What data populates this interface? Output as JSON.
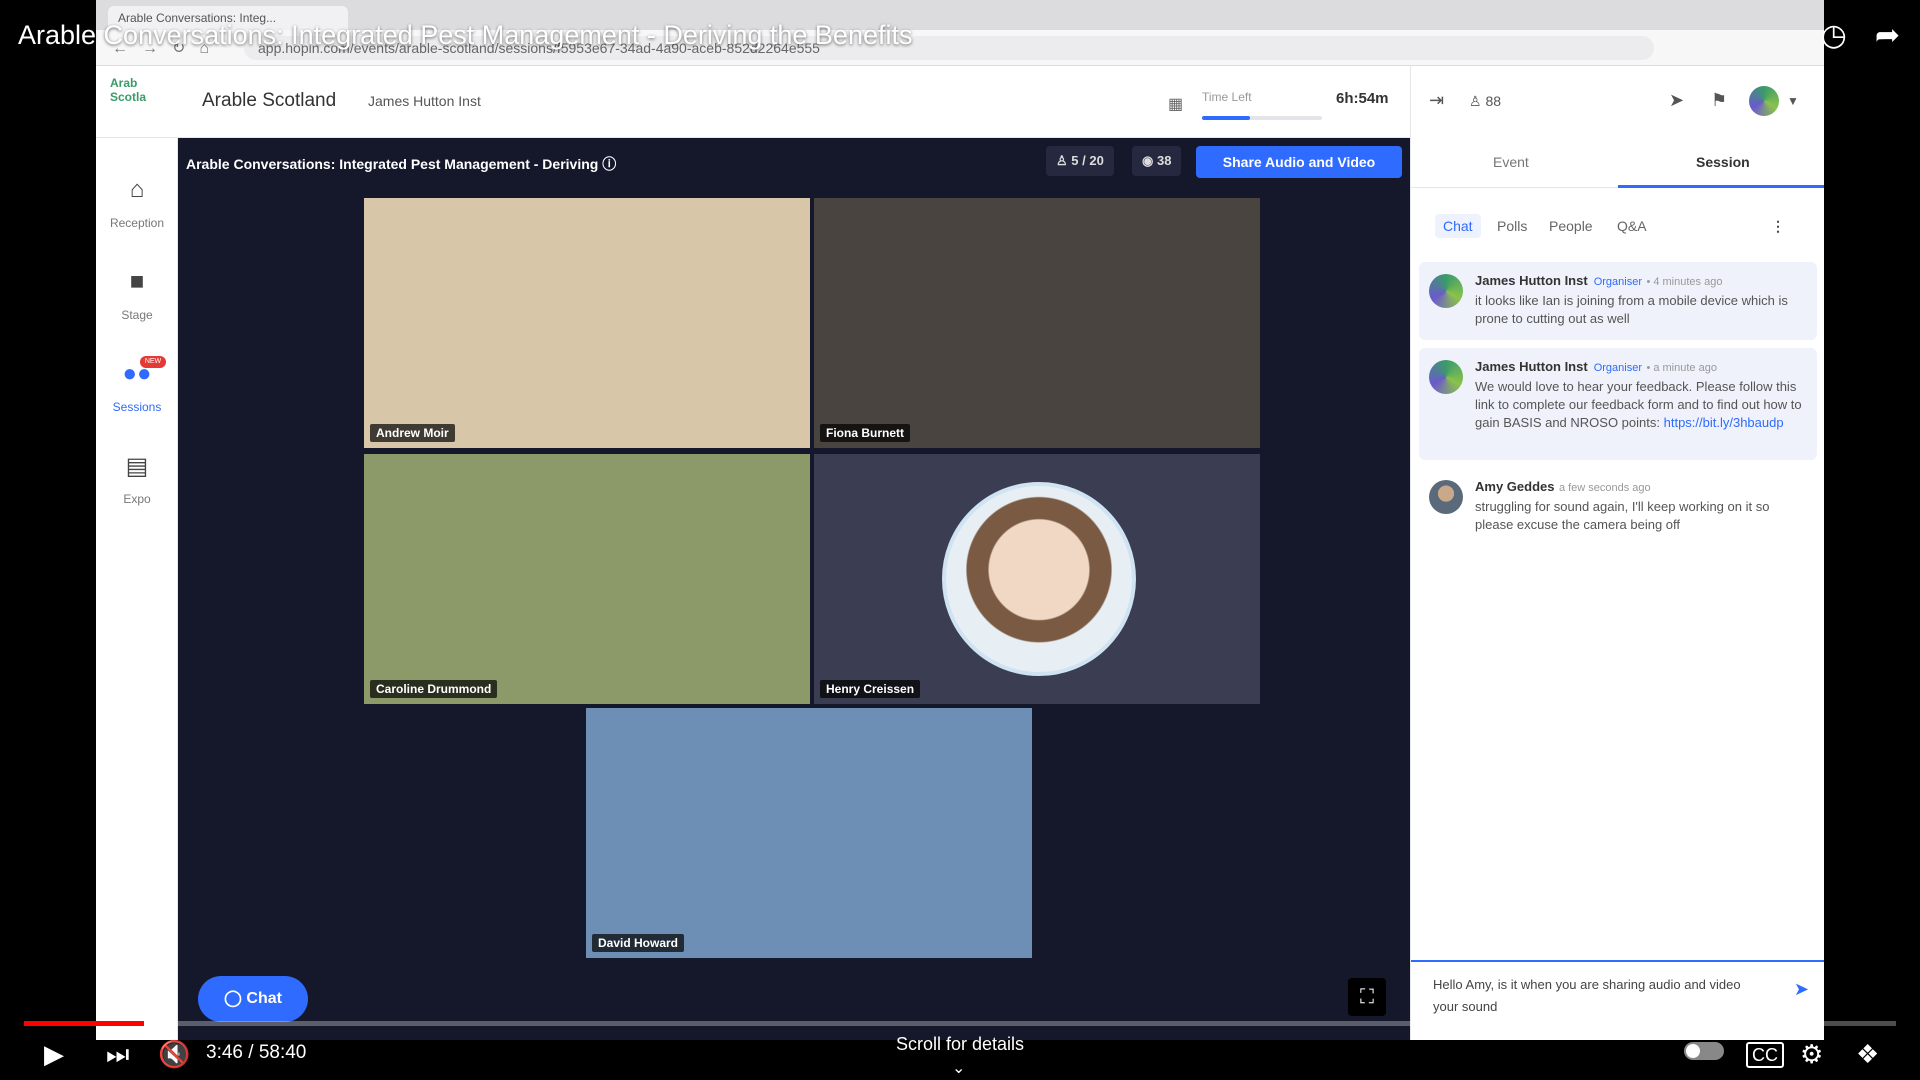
{
  "youtube": {
    "title": "Arable Conversations: Integrated Pest Management - Deriving the Benefits",
    "timecode": "3:46 / 58:40",
    "progress": 0.064,
    "scroll_hint": "Scroll for details",
    "icons": {
      "watch_later": "clock-icon",
      "share": "share-arrow-icon",
      "play": "play-icon",
      "next": "next-icon",
      "mute": "mute-icon",
      "cc": "cc-icon",
      "settings": "gear-icon",
      "exit_fullscreen": "exit-fullscreen-icon"
    }
  },
  "browser": {
    "tab_label": "Arable Conversations: Integ...",
    "url": "app.hopin.com/events/arable-scotland/sessions/f5953e67-34ad-4a90-aceb-852d2264e555"
  },
  "header": {
    "event_name": "Arable Scotland",
    "organizer": "James Hutton Inst",
    "logo_text": "Arab Scotla",
    "time_left_label": "Time Left",
    "time_left_value": "6h:54m",
    "time_left_progress": 0.4
  },
  "nav": {
    "items": [
      {
        "label": "Reception",
        "icon": "home-icon"
      },
      {
        "label": "Stage",
        "icon": "video-camera-icon"
      },
      {
        "label": "Sessions",
        "icon": "people-icon",
        "badge": "NEW"
      },
      {
        "label": "Expo",
        "icon": "booth-icon"
      }
    ]
  },
  "session": {
    "title": "Arable Conversations: Integrated Pest Management - Deriving",
    "participants": "5 / 20",
    "viewers": "38",
    "share_label": "Share Audio and Video",
    "chat_fab_label": "Chat",
    "tiles": [
      {
        "name": "Andrew Moir",
        "color": "#d8c6a8"
      },
      {
        "name": "Fiona Burnett",
        "color": "#4a4440"
      },
      {
        "name": "Caroline Drummond",
        "color": "#8c9a6a"
      },
      {
        "name": "Henry Creissen",
        "color": "#3b3e52"
      },
      {
        "name": "David Howard",
        "color": "#6d8fb5"
      }
    ]
  },
  "sidebar": {
    "attendee_count": "88",
    "tabs": [
      "Event",
      "Session"
    ],
    "subtabs": [
      "Chat",
      "Polls",
      "People",
      "Q&A"
    ],
    "messages": [
      {
        "author": "James Hutton Inst",
        "role": "Organiser",
        "time": "• 4 minutes ago",
        "text": "it looks like Ian is joining from a mobile device which is prone to cutting out as well",
        "link": ""
      },
      {
        "author": "James Hutton Inst",
        "role": "Organiser",
        "time": "• a minute ago",
        "text": "We would love to hear your feedback. Please follow this link to complete our feedback form and to find out how to gain BASIS and NROSO points: ",
        "link": "https://bit.ly/3hbaudp"
      },
      {
        "author": "Amy Geddes",
        "role": "",
        "time": "a few seconds ago",
        "text": "struggling for sound again, I'll keep working on it so please excuse the camera being off",
        "link": ""
      }
    ],
    "composer_text": "Hello Amy, is it when you are sharing audio and video your sound"
  }
}
